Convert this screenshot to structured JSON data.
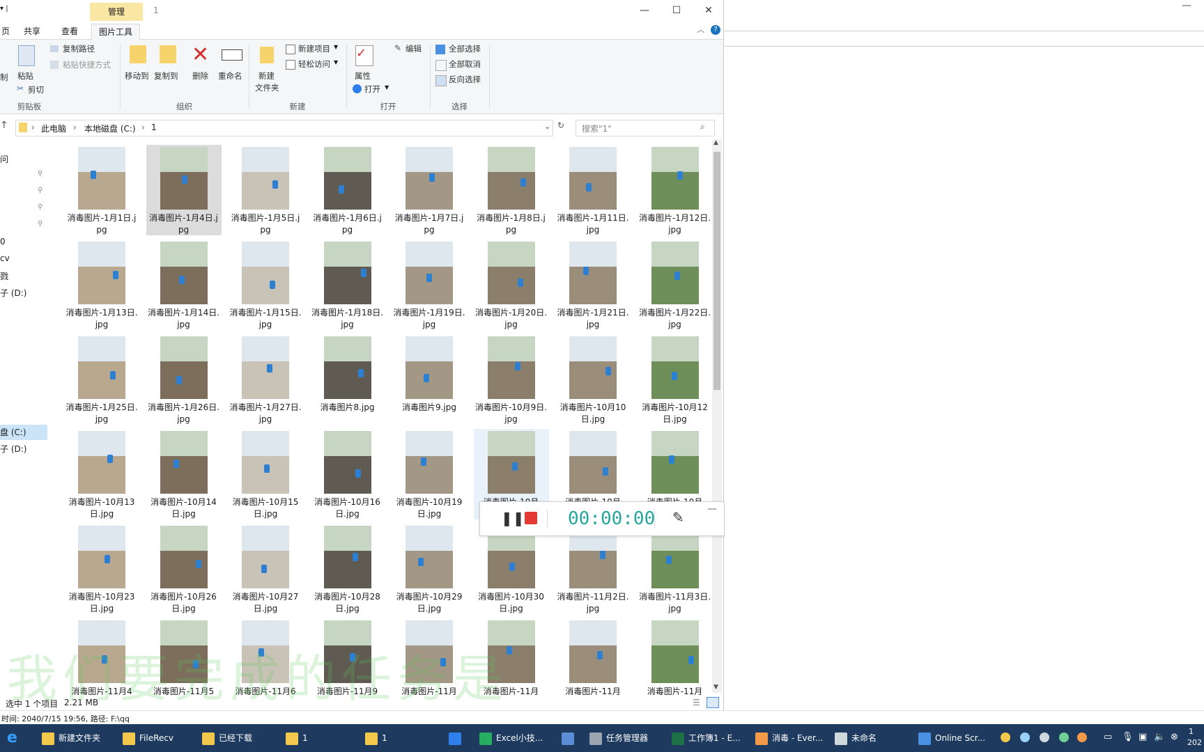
{
  "titlebar": {
    "context_tab": "管理",
    "window_title": "1",
    "minimize_glyph": "—",
    "maximize_glyph": "☐",
    "close_glyph": "✕"
  },
  "tabs": [
    {
      "label": "页",
      "active": false
    },
    {
      "label": "共享",
      "active": false
    },
    {
      "label": "查看",
      "active": false
    },
    {
      "label": "图片工具",
      "active": true
    }
  ],
  "ribbon": {
    "clipboard": {
      "cut_partial": "制",
      "paste": "粘贴",
      "copy_path": "复制路径",
      "paste_shortcut": "粘贴快捷方式",
      "cut": "剪切",
      "group": "剪贴板"
    },
    "organize": {
      "move_to": "移动到",
      "copy_to": "复制到",
      "delete": "删除",
      "rename": "重命名",
      "group": "组织"
    },
    "new": {
      "new_folder_line1": "新建",
      "new_folder_line2": "文件夹",
      "new_item": "新建项目",
      "easy_access": "轻松访问",
      "group": "新建"
    },
    "open": {
      "properties": "属性",
      "open": "打开",
      "edit": "编辑",
      "group": "打开"
    },
    "select": {
      "select_all": "全部选择",
      "select_none": "全部取消",
      "invert": "反向选择",
      "group": "选择"
    }
  },
  "address": {
    "crumbs": [
      "此电脑",
      "本地磁盘 (C:)",
      "1"
    ],
    "search_placeholder": "搜索\"1\""
  },
  "nav": {
    "items": [
      "问",
      "0",
      "cv",
      "戮",
      "子 (D:)",
      "盘 (C:)",
      "子 (D:)"
    ]
  },
  "files": [
    "消毒图片-1月1日.jpg",
    "消毒图片-1月4日.jpg",
    "消毒图片-1月5日.jpg",
    "消毒图片-1月6日.jpg",
    "消毒图片-1月7日.jpg",
    "消毒图片-1月8日.jpg",
    "消毒图片-1月11日.jpg",
    "消毒图片-1月12日.jpg",
    "消毒图片-1月13日.jpg",
    "消毒图片-1月14日.jpg",
    "消毒图片-1月15日.jpg",
    "消毒图片-1月18日.jpg",
    "消毒图片-1月19日.jpg",
    "消毒图片-1月20日.jpg",
    "消毒图片-1月21日.jpg",
    "消毒图片-1月22日.jpg",
    "消毒图片-1月25日.jpg",
    "消毒图片-1月26日.jpg",
    "消毒图片-1月27日.jpg",
    "消毒图片8.jpg",
    "消毒图片9.jpg",
    "消毒图片-10月9日.jpg",
    "消毒图片-10月10日.jpg",
    "消毒图片-10月12日.jpg",
    "消毒图片-10月13日.jpg",
    "消毒图片-10月14日.jpg",
    "消毒图片-10月15日.jpg",
    "消毒图片-10月16日.jpg",
    "消毒图片-10月19日.jpg",
    "消毒图片-10月",
    "消毒图片-10月",
    "消毒图片-10月",
    "消毒图片-10月23日.jpg",
    "消毒图片-10月26日.jpg",
    "消毒图片-10月27日.jpg",
    "消毒图片-10月28日.jpg",
    "消毒图片-10月29日.jpg",
    "消毒图片-10月30日.jpg",
    "消毒图片-11月2日.jpg",
    "消毒图片-11月3日.jpg",
    "消毒图片-11月4",
    "消毒图片-11月5",
    "消毒图片-11月6",
    "消毒图片-11月9",
    "消毒图片-11月",
    "消毒图片-11月",
    "消毒图片-11月",
    "消毒图片-11月"
  ],
  "status": {
    "selection": "选中 1 个项目",
    "size": "2.21 MB"
  },
  "recorder": {
    "time": "00:00:00"
  },
  "infoline": "时间: 2040/7/15 19:56, 路径: F:\\qq",
  "watermark": "我们要完成的任务是",
  "taskbar": {
    "items": [
      {
        "label": "新建文件夹",
        "color": "#f2c94c"
      },
      {
        "label": "FileRecv",
        "color": "#f2c94c"
      },
      {
        "label": "已经下载",
        "color": "#f2c94c"
      },
      {
        "label": "1",
        "color": "#f2c94c"
      },
      {
        "label": "1",
        "color": "#f2c94c"
      },
      {
        "label": "",
        "color": "#2f80ed"
      },
      {
        "label": "Excel小技...",
        "color": "#27ae60"
      },
      {
        "label": "",
        "color": "#5b8dd6"
      },
      {
        "label": "任务管理器",
        "color": "#9aa5b1"
      },
      {
        "label": "工作簿1 - E...",
        "color": "#1e7145"
      },
      {
        "label": "消毒 - Ever...",
        "color": "#f2994a"
      },
      {
        "label": "未命名",
        "color": "#cfd8dc"
      },
      {
        "label": "Online Scr...",
        "color": "#4a90e2"
      }
    ],
    "clock_time": "1",
    "clock_date": "202"
  },
  "colors": {
    "accent": "#0078d7",
    "context_tab": "#fbe7a4",
    "taskbar": "#1e3a5f",
    "record_red": "#e53935",
    "timer": "#26a69a"
  }
}
